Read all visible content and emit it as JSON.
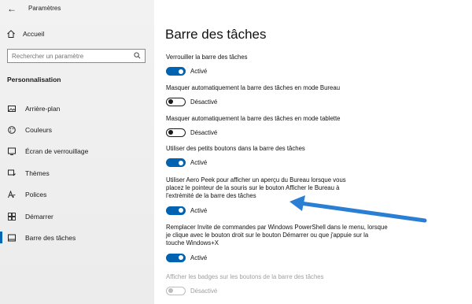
{
  "window": {
    "title": "Paramètres",
    "back_icon": "back-arrow-icon"
  },
  "sidebar": {
    "home_label": "Accueil",
    "search": {
      "placeholder": "Rechercher un paramètre",
      "value": ""
    },
    "section_title": "Personnalisation",
    "items": [
      {
        "label": "Arrière-plan",
        "icon": "picture-icon",
        "active": false
      },
      {
        "label": "Couleurs",
        "icon": "palette-icon",
        "active": false
      },
      {
        "label": "Écran de verrouillage",
        "icon": "lock-screen-icon",
        "active": false
      },
      {
        "label": "Thèmes",
        "icon": "brush-icon",
        "active": false
      },
      {
        "label": "Polices",
        "icon": "font-icon",
        "active": false
      },
      {
        "label": "Démarrer",
        "icon": "start-grid-icon",
        "active": false
      },
      {
        "label": "Barre des tâches",
        "icon": "taskbar-icon",
        "active": true
      }
    ]
  },
  "main": {
    "title": "Barre des tâches",
    "settings": [
      {
        "label": "Verrouiller la barre des tâches",
        "state": "Activé",
        "on": true,
        "enabled": true
      },
      {
        "label": "Masquer automatiquement la barre des tâches en mode Bureau",
        "state": "Désactivé",
        "on": false,
        "enabled": true
      },
      {
        "label": "Masquer automatiquement la barre des tâches en mode tablette",
        "state": "Désactivé",
        "on": false,
        "enabled": true
      },
      {
        "label": "Utiliser des petits boutons dans la barre des tâches",
        "state": "Activé",
        "on": true,
        "enabled": true
      },
      {
        "label": "Utiliser Aero Peek pour afficher un aperçu du Bureau lorsque vous placez le pointeur de la souris sur le bouton Afficher le Bureau à l'extrémité de la barre des tâches",
        "state": "Activé",
        "on": true,
        "enabled": true
      },
      {
        "label": "Remplacer Invite de commandes par Windows PowerShell dans le menu, lorsque je clique avec le bouton droit sur le bouton Démarrer ou que j'appuie sur la touche Windows+X",
        "state": "Activé",
        "on": true,
        "enabled": true
      },
      {
        "label": "Afficher les badges sur les boutons de la barre des tâches",
        "state": "Désactivé",
        "on": false,
        "enabled": false
      }
    ]
  },
  "colors": {
    "accent": "#0063b1",
    "annotation_arrow": "#2a7fd4"
  }
}
